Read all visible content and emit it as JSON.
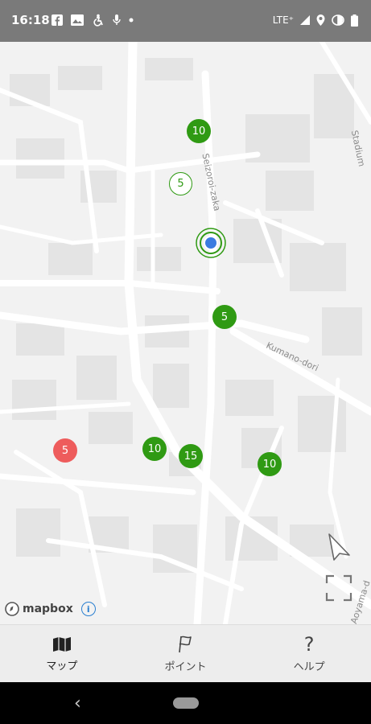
{
  "status_bar": {
    "time": "16:18",
    "network": "LTE⁺",
    "left_icons": [
      "facebook-icon",
      "gallery-icon",
      "accessibility-icon",
      "mic-icon",
      "dot-icon"
    ],
    "right_icons": [
      "signal-icon",
      "location-icon",
      "data-saver-icon",
      "battery-icon"
    ]
  },
  "map": {
    "street_labels": [
      "Seizoroi-zaka",
      "Kumano-dori",
      "Stadium",
      "Aoyama-d"
    ],
    "markers": [
      {
        "label": "10",
        "style": "filled-green"
      },
      {
        "label": "5",
        "style": "outline-green"
      },
      {
        "label": "5",
        "style": "filled-green"
      },
      {
        "label": "10",
        "style": "filled-green"
      },
      {
        "label": "15",
        "style": "filled-green"
      },
      {
        "label": "10",
        "style": "filled-green"
      },
      {
        "label": "5",
        "style": "filled-red"
      }
    ],
    "attribution": "mapbox",
    "info_glyph": "i"
  },
  "bottom_nav": {
    "items": [
      {
        "label": "マップ",
        "icon": "map-icon"
      },
      {
        "label": "ポイント",
        "icon": "flag-icon"
      },
      {
        "label": "ヘルプ",
        "icon": "help-icon",
        "glyph": "?"
      }
    ]
  },
  "colors": {
    "marker_green": "#2f9a13",
    "marker_red": "#ee5c5c",
    "user_location": "#3b7be0"
  }
}
